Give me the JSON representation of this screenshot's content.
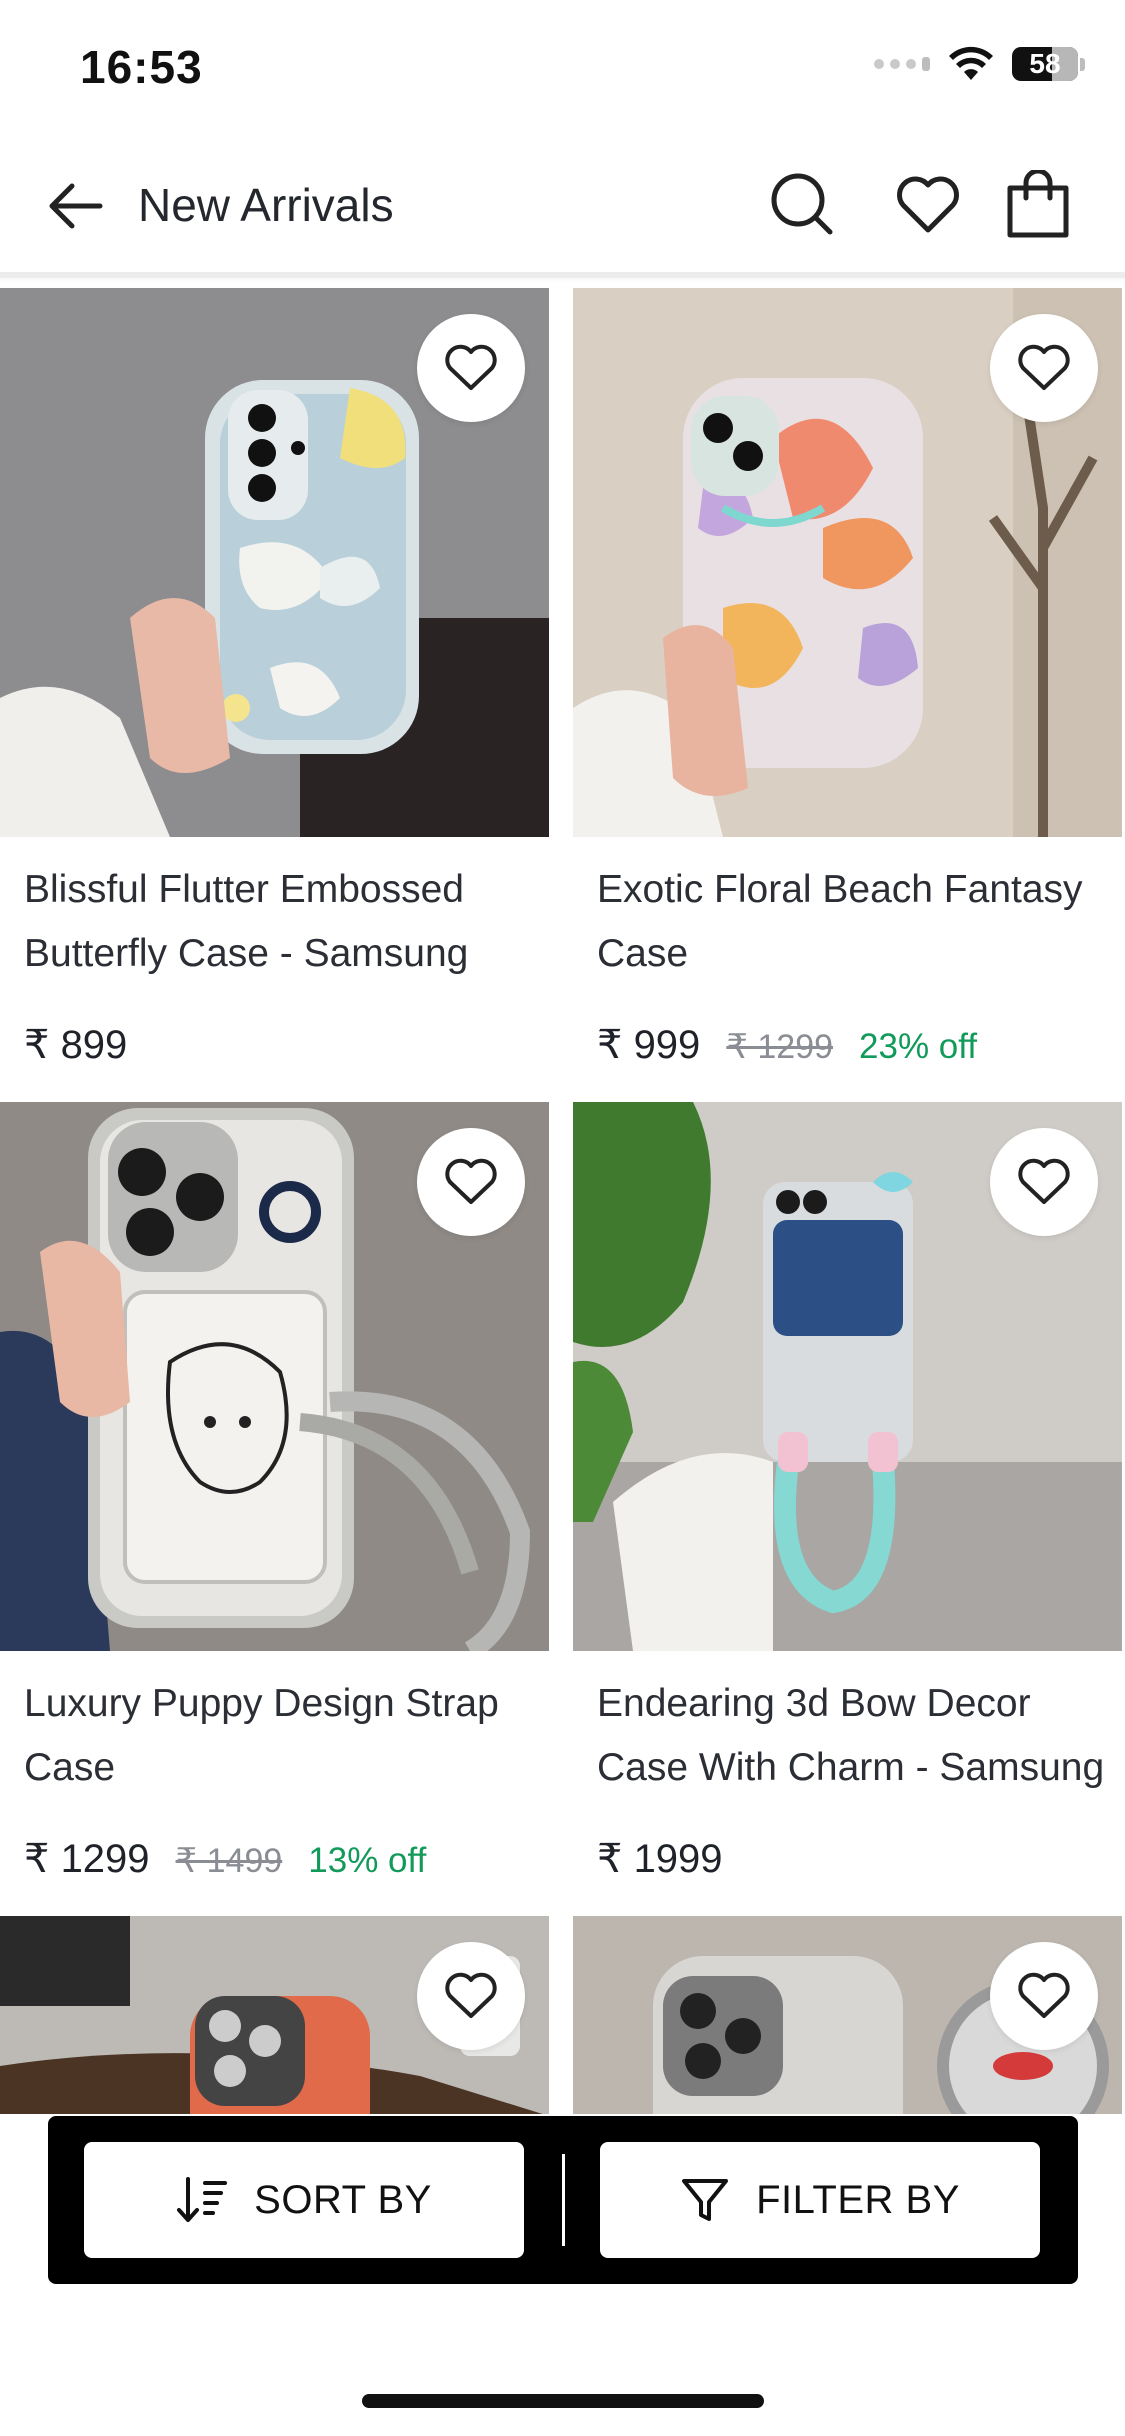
{
  "status_bar": {
    "time": "16:53",
    "battery": "58"
  },
  "header": {
    "title": "New Arrivals"
  },
  "products": [
    {
      "name": "Blissful Flutter Embossed Butterfly Case - Samsung",
      "price": "₹ 899",
      "original_price": "",
      "discount": ""
    },
    {
      "name": "Exotic Floral Beach Fantasy Case",
      "price": "₹ 999",
      "original_price": "₹ 1299",
      "discount": "23% off"
    },
    {
      "name": "Luxury Puppy Design Strap Case",
      "price": "₹ 1299",
      "original_price": "₹ 1499",
      "discount": "13% off"
    },
    {
      "name": "Endearing 3d Bow Decor Case With Charm - Samsung",
      "price": "₹ 1999",
      "original_price": "",
      "discount": ""
    },
    {
      "name": "",
      "price": "",
      "original_price": "",
      "discount": ""
    },
    {
      "name": "",
      "price": "",
      "original_price": "",
      "discount": ""
    }
  ],
  "bottom_bar": {
    "sort_label": "SORT BY",
    "filter_label": "FILTER BY"
  },
  "colors": {
    "discount": "#129a5a",
    "bottom_bar": "#000000"
  },
  "icons": [
    "back-arrow-icon",
    "search-icon",
    "heart-icon",
    "shopping-bag-icon",
    "sort-icon",
    "filter-icon"
  ]
}
